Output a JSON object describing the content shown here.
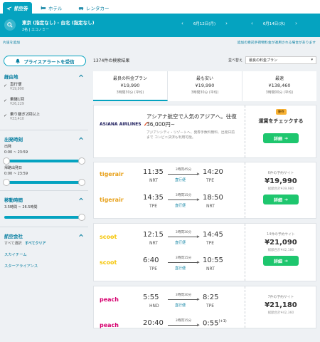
{
  "tabs": [
    {
      "label": "航空券",
      "active": true
    },
    {
      "label": "ホテル",
      "active": false
    },
    {
      "label": "レンタカー",
      "active": false
    }
  ],
  "search": {
    "route": "東京 (指定なし) - 台北 (指定なし)",
    "pax": "2名 | エコノミー",
    "date_out": "6月12日(月)",
    "date_back": "6月14日(水)"
  },
  "notices": {
    "left": "片道を追加",
    "right": "追加の受託手荷物料金が適用される場合があります"
  },
  "alert_button": "プライスアラートを受信",
  "sidebar": {
    "stops": {
      "title": "経由地",
      "options": [
        {
          "label": "直行便",
          "price": "¥19,990"
        },
        {
          "label": "乗継1回",
          "price": "¥26,229"
        },
        {
          "label": "乗り継ぎ2回以上",
          "price": "¥33,410"
        }
      ]
    },
    "times": {
      "title": "出発時刻",
      "outbound_label": "出発",
      "outbound_range": "0:00 ~ 23:59",
      "return_label": "帰路出発日",
      "return_range": "0:00 ~ 23:59"
    },
    "duration": {
      "title": "移動時間",
      "range": "3.5時間 ~ 26.5時間"
    },
    "airlines": {
      "title": "航空会社",
      "select_all": "すべて選択",
      "clear_all": "すべてクリア",
      "items": [
        "スカイチーム",
        "スターアライアンス"
      ]
    }
  },
  "results": {
    "count": "1374件の検索結果",
    "sort_label": "並べ替え",
    "sort_value": "最良の料金プラン",
    "tabs": [
      {
        "label": "最良の料金プラン",
        "price": "¥19,990",
        "time": "3時間30分 (平均)"
      },
      {
        "label": "最も安い",
        "price": "¥19,990",
        "time": "3時間30分 (平均)"
      },
      {
        "label": "最速",
        "price": "¥138,460",
        "time": "3時間00分 (平均)"
      }
    ]
  },
  "ad": {
    "logo": "ASIANA AIRLINES",
    "title": "アシアナ航空で人気のアジアへ。往復36,000円~",
    "desc": "アジアンシティ・リゾートへ、発券手数料無料、出発日前まで コンビニ決済も利用可能。",
    "badge": "優待",
    "cta": "運賃をチェックする",
    "button": "詳細"
  },
  "flights": [
    {
      "legs": [
        {
          "airline": "tigerair",
          "dep": "11:35",
          "dep_ap": "NRT",
          "dur": "3時間45分",
          "direct": "直行便",
          "arr": "14:20",
          "arr_ap": "TPE"
        },
        {
          "airline": "tigerair",
          "dep": "14:35",
          "dep_ap": "TPE",
          "dur": "3時間15分",
          "direct": "直行便",
          "arr": "18:50",
          "arr_ap": "NRT"
        }
      ],
      "sites": "6件の予約サイト",
      "price": "¥19,990",
      "total": "総額合計¥39,980",
      "button": "詳細"
    },
    {
      "legs": [
        {
          "airline": "scoot",
          "dep": "12:15",
          "dep_ap": "NRT",
          "dur": "3時間30分",
          "direct": "直行便",
          "arr": "14:45",
          "arr_ap": "TPE"
        },
        {
          "airline": "scoot",
          "dep": "6:40",
          "dep_ap": "TPE",
          "dur": "3時間15分",
          "direct": "直行便",
          "arr": "10:55",
          "arr_ap": "NRT"
        }
      ],
      "sites": "14件の予約サイト",
      "price": "¥21,090",
      "total": "総額合計¥42,180",
      "button": "詳細"
    },
    {
      "legs": [
        {
          "airline": "peach",
          "dep": "5:55",
          "dep_ap": "HND",
          "dur": "3時間30分",
          "direct": "直行便",
          "arr": "8:25",
          "arr_ap": "TPE"
        },
        {
          "airline": "peach",
          "dep": "20:40",
          "dep_ap": "",
          "dur": "3時間15分",
          "direct": "",
          "arr": "0:55",
          "arr_ap": "",
          "plus": "(+1)"
        }
      ],
      "sites": "7件の予約サイト",
      "price": "¥21,180",
      "total": "総額合計¥42,360",
      "button": "詳細"
    }
  ],
  "colors": {
    "primary": "#05a3c0",
    "cta": "#1ec66e",
    "tigerair": "#e8a21d",
    "scoot": "#f5c400",
    "peach": "#d6006f"
  }
}
